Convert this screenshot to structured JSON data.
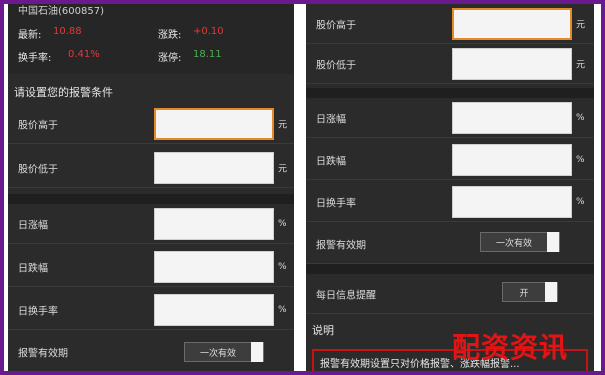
{
  "left": {
    "stock": {
      "code_line": "中国石油(600857)",
      "latest_label": "最新:",
      "latest_value": "10.88",
      "change_label": "涨跌:",
      "change_value": "+0.10",
      "turnover_label": "换手率:",
      "turnover_value": "0.41%",
      "pct_label": "涨停:",
      "pct_value": "18.11"
    },
    "section_title": "请设置您的报警条件",
    "rows": [
      {
        "label": "股价高于",
        "unit": "元"
      },
      {
        "label": "股价低于",
        "unit": "元"
      },
      {
        "label": "日涨幅",
        "unit": "%"
      },
      {
        "label": "日跌幅",
        "unit": "%"
      },
      {
        "label": "日换手率",
        "unit": "%"
      }
    ],
    "alert_valid_label": "报警有效期",
    "alert_valid_value": "一次有效"
  },
  "right": {
    "rows": [
      {
        "label": "股价高于",
        "unit": "元"
      },
      {
        "label": "股价低于",
        "unit": "元"
      },
      {
        "label": "日涨幅",
        "unit": "%"
      },
      {
        "label": "日跌幅",
        "unit": "%"
      },
      {
        "label": "日换手率",
        "unit": "%"
      }
    ],
    "alert_valid_label": "报警有效期",
    "alert_valid_value": "一次有效",
    "daily_remind_label": "每日信息提醒",
    "daily_remind_value": "开",
    "section_note": "说明",
    "note_text": "报警有效期设置只对价格报警、涨跌幅报警..."
  },
  "watermark": "配资资讯"
}
